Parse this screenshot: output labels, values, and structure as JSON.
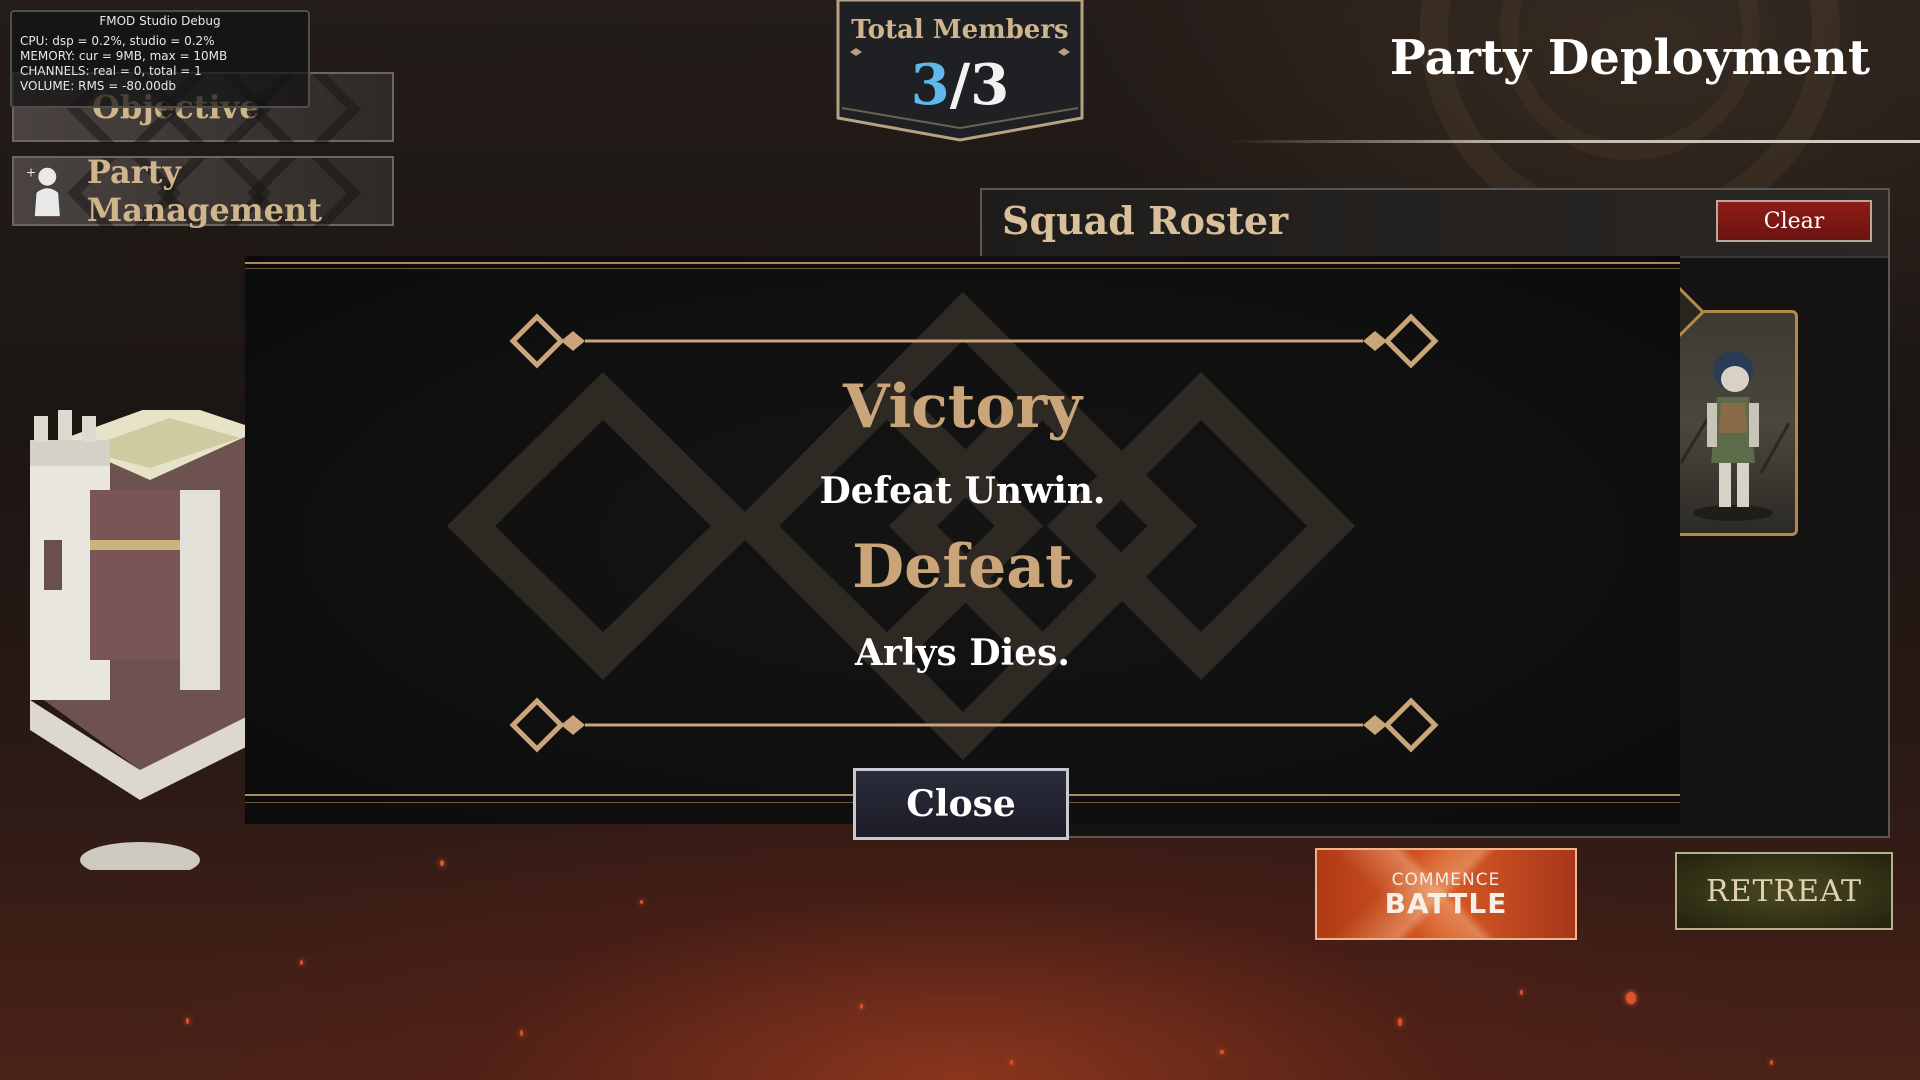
{
  "debug": {
    "title": "FMOD Studio Debug",
    "lines": [
      "CPU: dsp = 0.2%, studio = 0.2%",
      "MEMORY: cur = 9MB, max = 10MB",
      "CHANNELS: real = 0, total = 1",
      "VOLUME: RMS = -80.00db"
    ]
  },
  "sidebar": {
    "tabs": [
      {
        "label": "Objective"
      },
      {
        "label": "Party Management"
      }
    ]
  },
  "members": {
    "label": "Total Members",
    "current": "3",
    "separator": "/",
    "max": "3"
  },
  "header": {
    "title": "Party Deployment"
  },
  "roster": {
    "title": "Squad Roster",
    "clear_label": "Clear"
  },
  "modal": {
    "victory_title": "Victory",
    "victory_condition": "Defeat Unwin.",
    "defeat_title": "Defeat",
    "defeat_condition": "Arlys Dies.",
    "close_label": "Close"
  },
  "actions": {
    "commence_line1": "COMMENCE",
    "commence_line2": "BATTLE",
    "retreat_label": "RETREAT"
  },
  "colors": {
    "gold": "#caa57a",
    "accent_blue": "#5fb8ea",
    "clear_red": "#8e1d18"
  }
}
